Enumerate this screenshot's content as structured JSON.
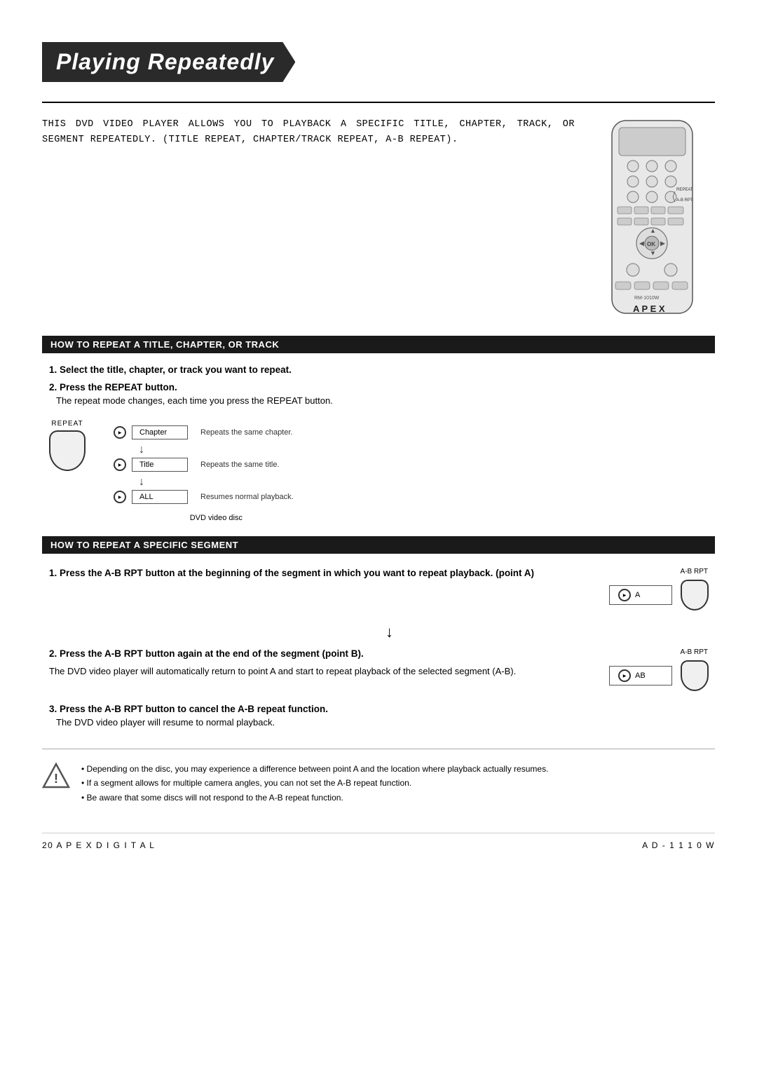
{
  "page": {
    "title": "Playing Repeatedly",
    "intro": "THIS DVD VIDEO PLAYER ALLOWS YOU TO PLAYBACK A SPECIFIC TITLE, CHAPTER, TRACK, OR SEGMENT REPEATEDLY. (TITLE REPEAT, CHAPTER/TRACK REPEAT, A-B REPEAT).",
    "section1": {
      "header": "HOW TO REPEAT A TITLE, CHAPTER, OR TRACK",
      "step1": "1.  Select the title, chapter, or track you want to repeat.",
      "step2": "2.  Press the REPEAT button.",
      "step2_desc": "The repeat mode changes, each time you press the REPEAT button.",
      "repeat_label": "REPEAT",
      "dvd_label": "DVD video disc",
      "flow": [
        {
          "mode": "Chapter",
          "desc": "Repeats the same chapter."
        },
        {
          "mode": "Title",
          "desc": "Repeats the same title."
        },
        {
          "mode": "ALL",
          "desc": "Resumes normal playback."
        }
      ]
    },
    "section2": {
      "header": "HOW TO REPEAT A SPECIFIC SEGMENT",
      "step1_title": "1.  Press the A-B RPT button at the beginning of the segment in which you want to repeat playback. (point A)",
      "step2_title": "2.  Press the A-B RPT button again at the end of the segment (point B).",
      "step2_desc": "The DVD video player will automatically return to point A and start to repeat playback of the selected segment (A-B).",
      "step3_title": "3.  Press the A-B RPT button to cancel the A-B repeat function.",
      "step3_desc": "The DVD video player will resume to normal playback.",
      "ab_label1": "A-B RPT",
      "ab_label2": "A-B RPT",
      "ab_point_a": "A",
      "ab_point_ab": "AB"
    },
    "caution": {
      "title": "Caution",
      "items": [
        "Depending on the disc, you may experience a difference between point A and the location where playback actually resumes.",
        "If a segment allows for multiple camera angles, you can not set the A-B repeat function.",
        "Be aware that some discs will not respond to the A-B repeat function."
      ]
    },
    "footer": {
      "left": "20   A P E X   D I G I T A L",
      "right": "A D - 1 1 1 0 W"
    }
  }
}
